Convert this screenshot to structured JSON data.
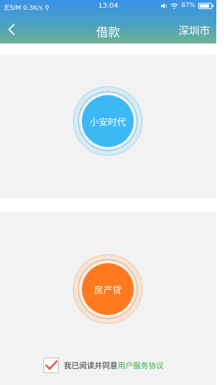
{
  "status_bar": {
    "carrier": "无SIM",
    "speed": "0.3K/s",
    "time": "13:04",
    "battery": "87%",
    "battery_level": 0.87
  },
  "nav": {
    "back_icon": "chevron-left-icon",
    "title": "借款",
    "city": "深圳市"
  },
  "options": [
    {
      "label": "小安时代",
      "color": "#3cb9f5"
    },
    {
      "label": "房产贷",
      "color": "#ff7a1f"
    }
  ],
  "agreement": {
    "checked": true,
    "text": "我已阅读并同意",
    "link": "用户服务协议",
    "check_color": "#e8553a",
    "link_color": "#35b34a"
  },
  "colors": {
    "header_top": "#3a93e6",
    "header_bottom": "#6fb296",
    "panel_bg": "#f2f2f2"
  }
}
